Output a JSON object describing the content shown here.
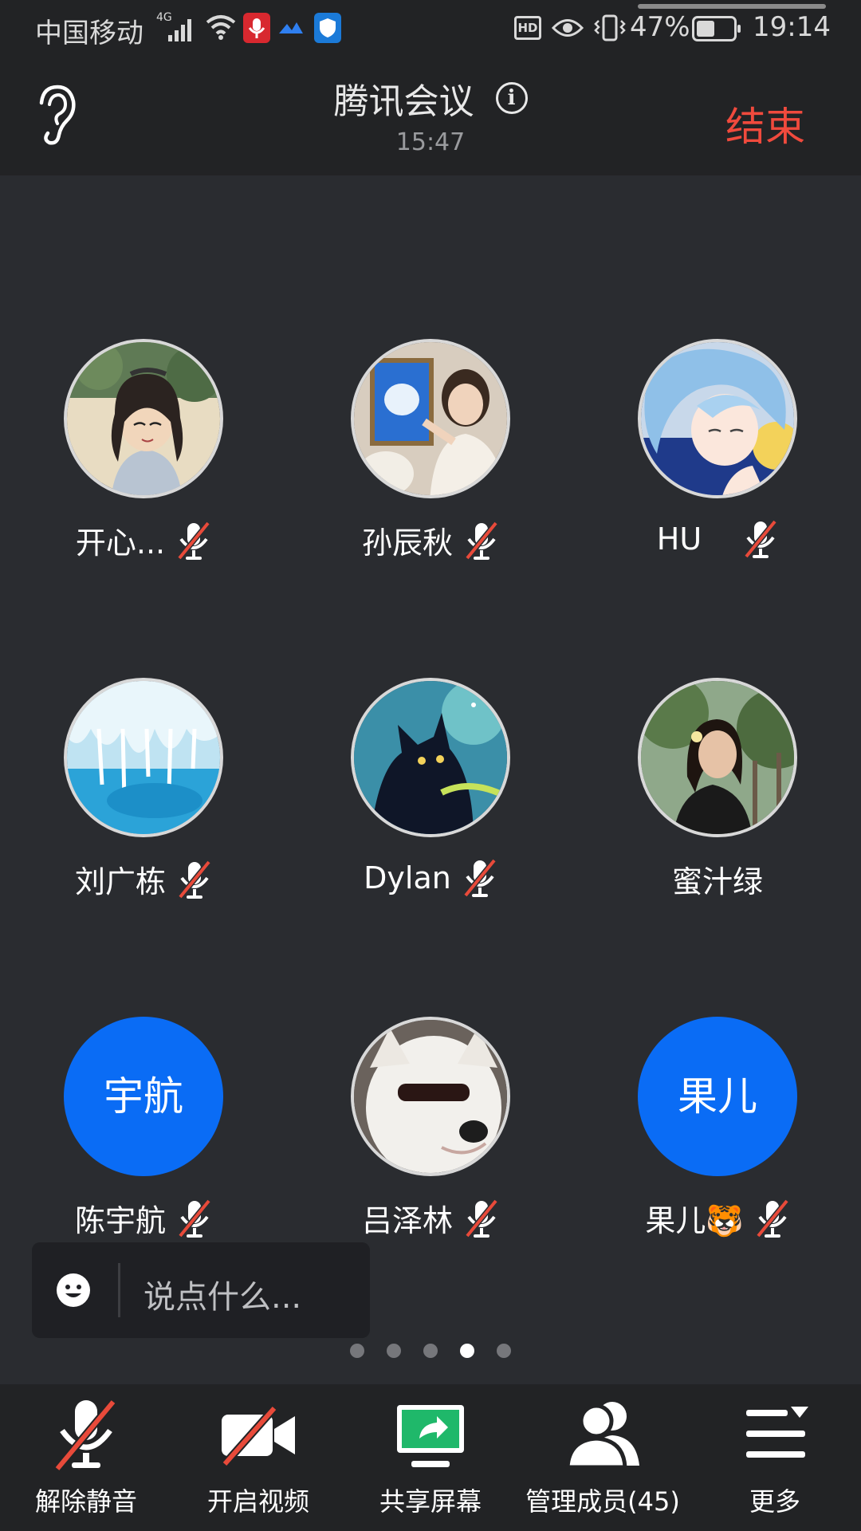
{
  "status_bar": {
    "carrier": "中国移动",
    "network": "4G",
    "battery": "47%",
    "time": "19:14",
    "hd_label": "HD"
  },
  "header": {
    "title": "腾讯会议",
    "elapsed": "15:47",
    "end_label": "结束"
  },
  "participants": [
    {
      "name": "开心...",
      "muted": true,
      "avatar_icon": "photo-anime-girl-sunglasses"
    },
    {
      "name": "孙辰秋",
      "muted": true,
      "avatar_icon": "photo-girl-painting"
    },
    {
      "name": "HU",
      "muted": true,
      "avatar_icon": "photo-anime-blue-hair"
    },
    {
      "name": "刘广栋",
      "muted": true,
      "avatar_icon": "photo-ice-cave"
    },
    {
      "name": "Dylan",
      "muted": true,
      "avatar_icon": "photo-cat-night"
    },
    {
      "name": "蜜汁绿",
      "muted": false,
      "avatar_icon": "photo-girl-trees"
    },
    {
      "name": "陈宇航",
      "muted": true,
      "initials": "宇航"
    },
    {
      "name": "吕泽林",
      "muted": true,
      "avatar_icon": "photo-dog-sunglasses"
    },
    {
      "name": "果儿🐯",
      "muted": true,
      "initials": "果儿"
    }
  ],
  "chat": {
    "placeholder": "说点什么..."
  },
  "pager": {
    "total": 5,
    "active_index": 3
  },
  "toolbar": {
    "unmute_label": "解除静音",
    "video_label": "开启视频",
    "share_label": "共享屏幕",
    "members_label": "管理成员(45)",
    "more_label": "更多"
  },
  "colors": {
    "background": "#2a2c30",
    "bar": "#222325",
    "end_red": "#f04a3d",
    "initials_blue": "#0a6cf5",
    "share_green": "#1fb86a",
    "mute_slash": "#e84a3a"
  }
}
